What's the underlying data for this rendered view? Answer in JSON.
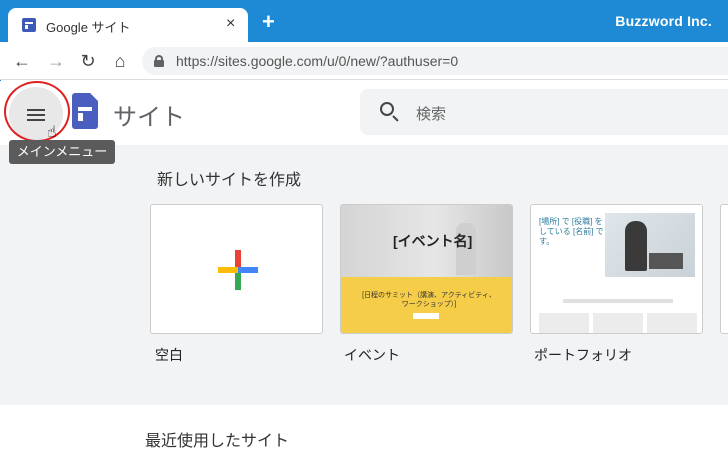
{
  "browser": {
    "tab_title": "Google サイト",
    "tab_close": "×",
    "new_tab": "+",
    "window_title": "Buzzword Inc.",
    "url": "https://sites.google.com/u/0/new/?authuser=0",
    "nav": {
      "back": "←",
      "forward": "→",
      "reload": "↻",
      "home": "⌂"
    }
  },
  "app": {
    "name": "サイト",
    "search_placeholder": "検索",
    "menu_tooltip": "メインメニュー"
  },
  "templates": {
    "heading": "新しいサイトを作成",
    "items": [
      {
        "label": "空白"
      },
      {
        "label": "イベント",
        "thumb_title": "[イベント名]",
        "thumb_text": "[日程のサミット（講演、アクティビティ、ワークショップ）]"
      },
      {
        "label": "ポートフォリオ",
        "thumb_text": "[場所] で [役職] をしている [名前] です。"
      }
    ]
  },
  "recent": {
    "heading": "最近使用したサイト"
  },
  "colors": {
    "chrome_blue": "#1e8ad6",
    "sites_blue": "#4a5ec0",
    "highlight_ring": "#e02020"
  }
}
